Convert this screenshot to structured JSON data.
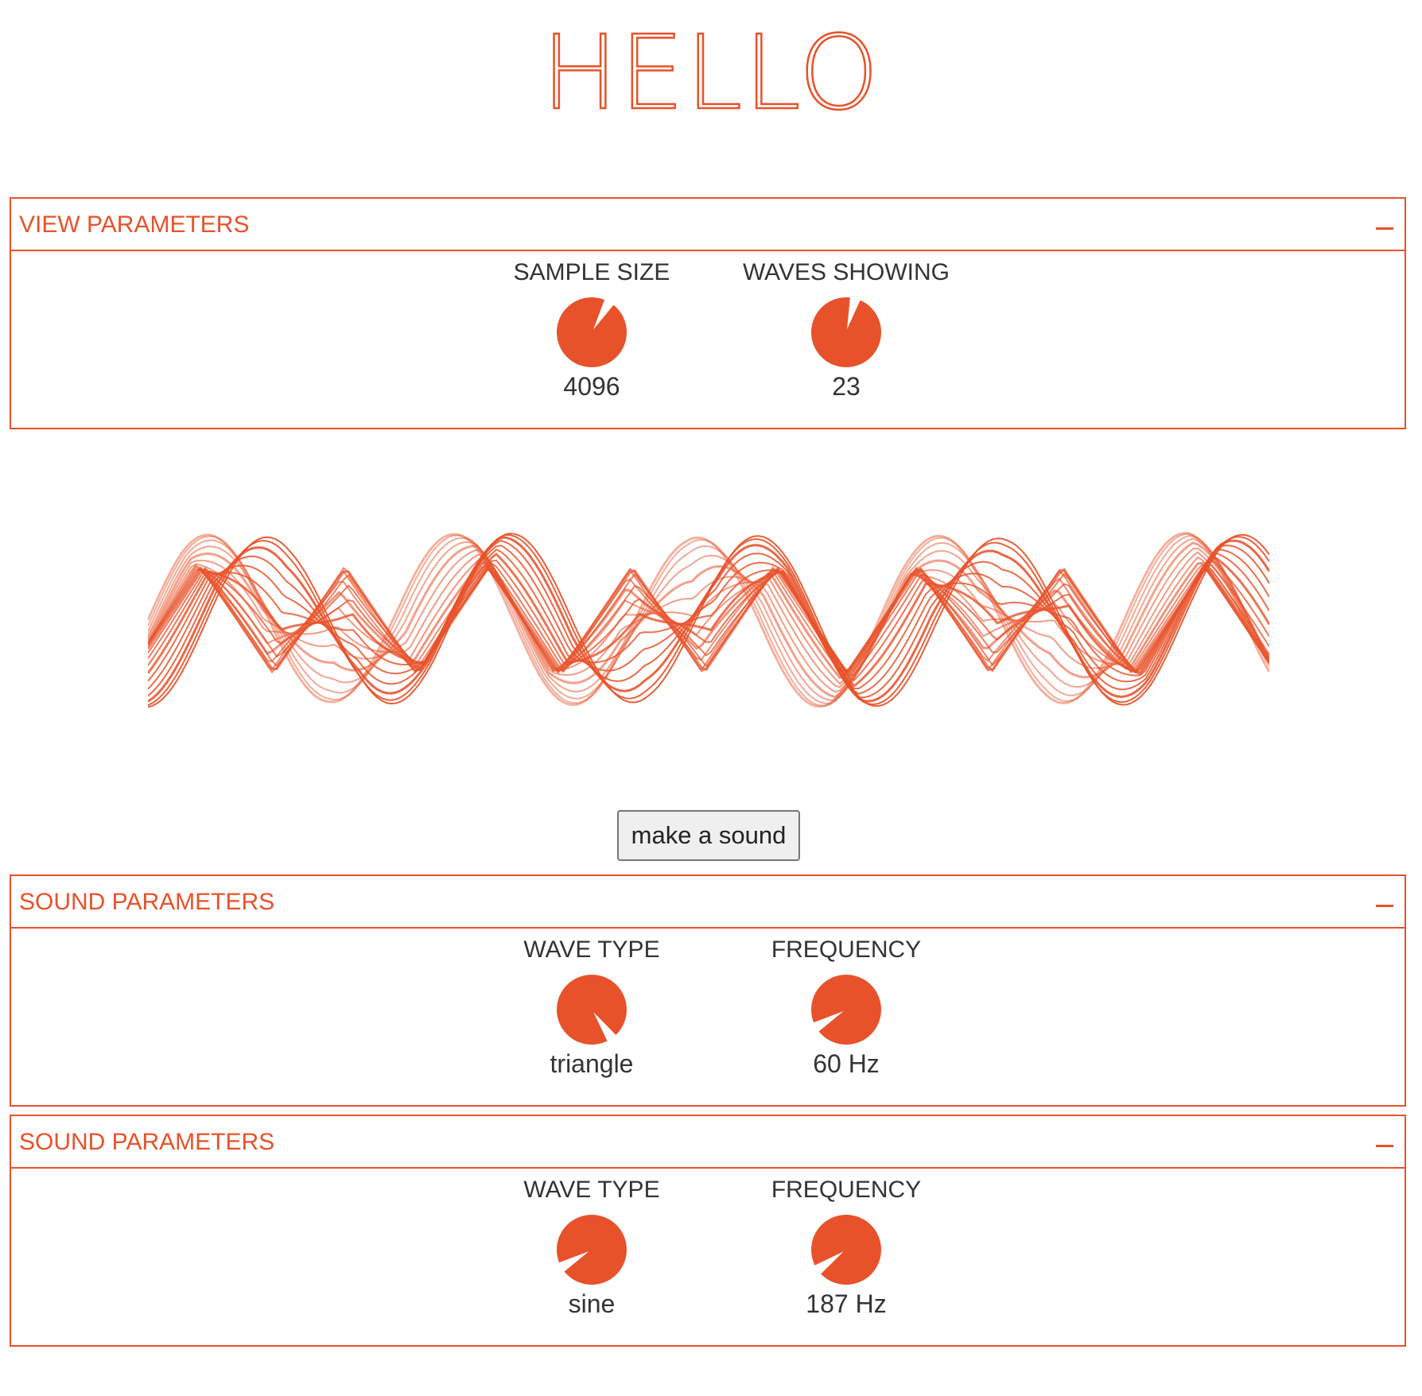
{
  "title": "HELLO",
  "accent_color": "#e8522a",
  "view_panel": {
    "title": "VIEW PARAMETERS",
    "collapse_icon": "minus-icon",
    "controls": [
      {
        "label": "SAMPLE SIZE",
        "value": "4096",
        "knob_angle_deg": 60
      },
      {
        "label": "WAVES SHOWING",
        "value": "23",
        "knob_angle_deg": 75
      }
    ]
  },
  "make_sound_button": "make a sound",
  "sound_panel_1": {
    "title": "SOUND PARAMETERS",
    "collapse_icon": "minus-icon",
    "controls": [
      {
        "label": "WAVE TYPE",
        "value": "triangle",
        "knob_angle_deg": -55
      },
      {
        "label": "FREQUENCY",
        "value": "60 Hz",
        "knob_angle_deg": -150
      }
    ]
  },
  "sound_panel_2": {
    "title": "SOUND PARAMETERS",
    "collapse_icon": "minus-icon",
    "controls": [
      {
        "label": "WAVE TYPE",
        "value": "sine",
        "knob_angle_deg": -150
      },
      {
        "label": "FREQUENCY",
        "value": "187 Hz",
        "knob_angle_deg": -145
      }
    ]
  }
}
